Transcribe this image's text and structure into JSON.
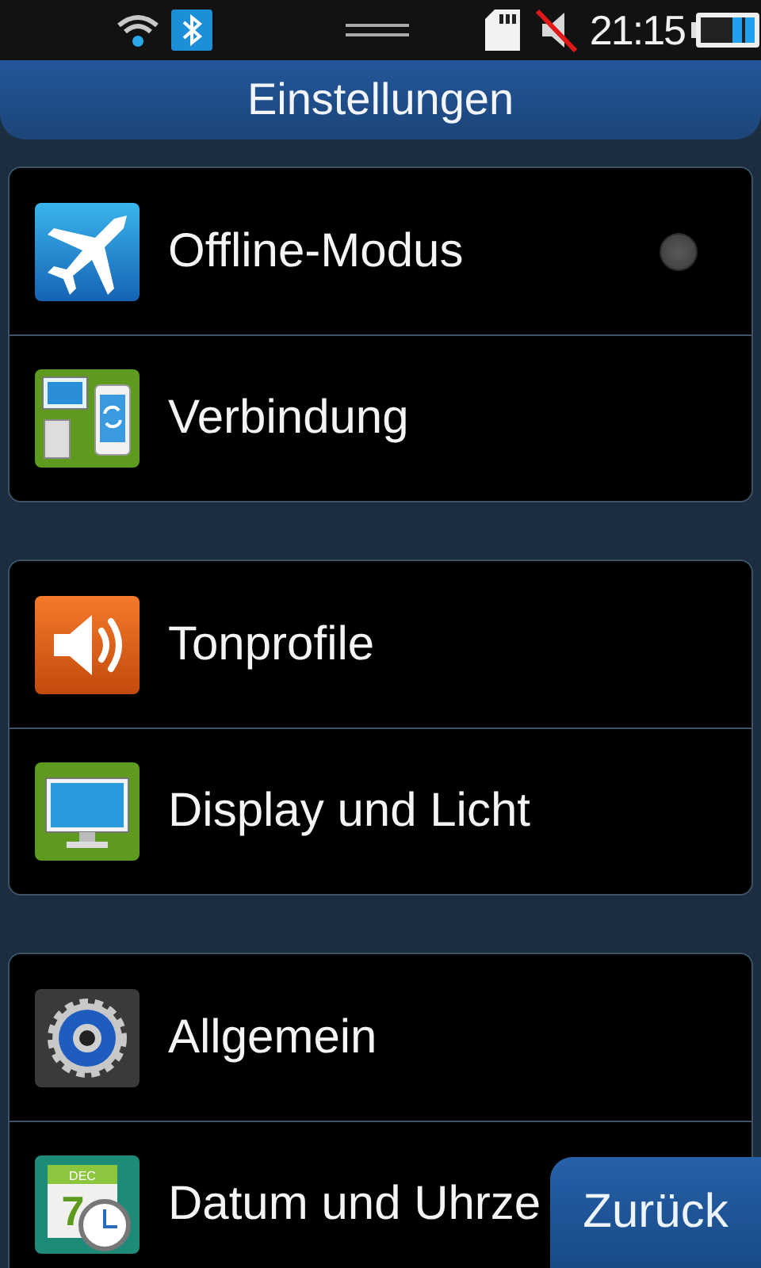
{
  "status_bar": {
    "time": "21:15"
  },
  "header": {
    "title": "Einstellungen"
  },
  "groups": [
    {
      "items": [
        {
          "label": "Offline-Modus",
          "kind": "toggle",
          "on": false
        },
        {
          "label": "Verbindung",
          "kind": "link"
        }
      ]
    },
    {
      "items": [
        {
          "label": "Tonprofile",
          "kind": "link"
        },
        {
          "label": "Display und Licht",
          "kind": "link"
        }
      ]
    },
    {
      "items": [
        {
          "label": "Allgemein",
          "kind": "link"
        },
        {
          "label": "Datum und Uhrze",
          "kind": "link",
          "icon_month": "DEC",
          "icon_day": "7"
        }
      ]
    }
  ],
  "back_button": {
    "label": "Zurück"
  }
}
